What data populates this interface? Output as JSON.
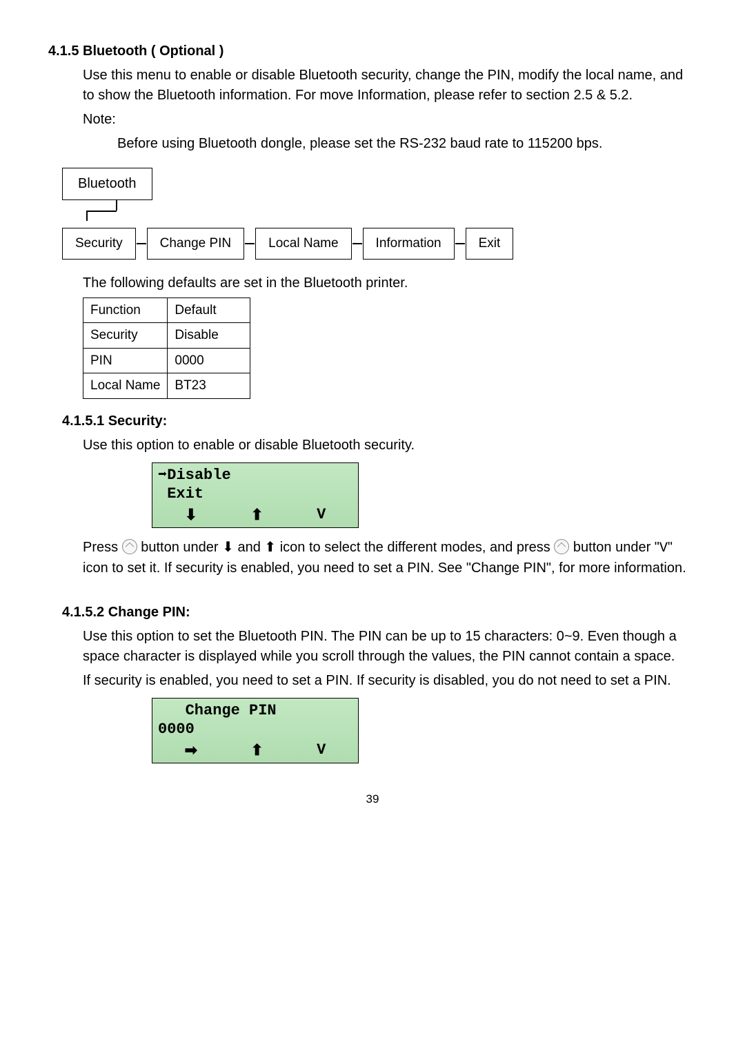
{
  "section1": {
    "heading": "4.1.5 Bluetooth ( Optional )",
    "para1": "Use this menu to enable or disable Bluetooth security, change the PIN, modify the local name, and to show the Bluetooth information. For move Information, please refer to section 2.5 & 5.2.",
    "noteLabel": "Note:",
    "noteBody": "Before using Bluetooth dongle, please set the RS-232 baud rate to 115200 bps."
  },
  "tree": {
    "parent": "Bluetooth",
    "children": [
      "Security",
      "Change PIN",
      "Local Name",
      "Information",
      "Exit"
    ]
  },
  "defaults": {
    "caption": "The following defaults are set in the Bluetooth printer.",
    "headers": [
      "Function",
      "Default"
    ],
    "rows": [
      [
        "Security",
        "Disable"
      ],
      [
        "PIN",
        "0000"
      ],
      [
        "Local Name",
        "BT23"
      ]
    ]
  },
  "section2": {
    "heading": "4.1.5.1 Security:",
    "intro": "Use this option to enable or disable Bluetooth security.",
    "lcd": {
      "line1": "➡Disable",
      "line2": " Exit",
      "icons": [
        "⬇",
        "⬆",
        "V"
      ]
    },
    "pressPart1": "Press ",
    "pressPart2": " button under ",
    "downArrow": "⬇",
    "pressPart3": " and ",
    "upArrow": "⬆",
    "pressPart4": " icon to select the different modes, and press ",
    "pressPart5": " button under \"",
    "vKey": "V",
    "pressPart6": "\" icon to set it. If security is enabled, you need to set a PIN. See \"Change PIN\", for more information."
  },
  "section3": {
    "heading": "4.1.5.2 Change PIN:",
    "para1": "Use this option to set the Bluetooth PIN. The PIN can be up to 15 characters: 0~9. Even though a space character is displayed while you scroll through the values, the PIN cannot contain a space.",
    "para2": "If security is enabled, you need to set a PIN. If security is disabled, you do not need to set a PIN.",
    "lcd": {
      "line1": "   Change PIN",
      "line2": "0000",
      "icons": [
        "➡",
        "⬆",
        "V"
      ]
    }
  },
  "pageNumber": "39"
}
